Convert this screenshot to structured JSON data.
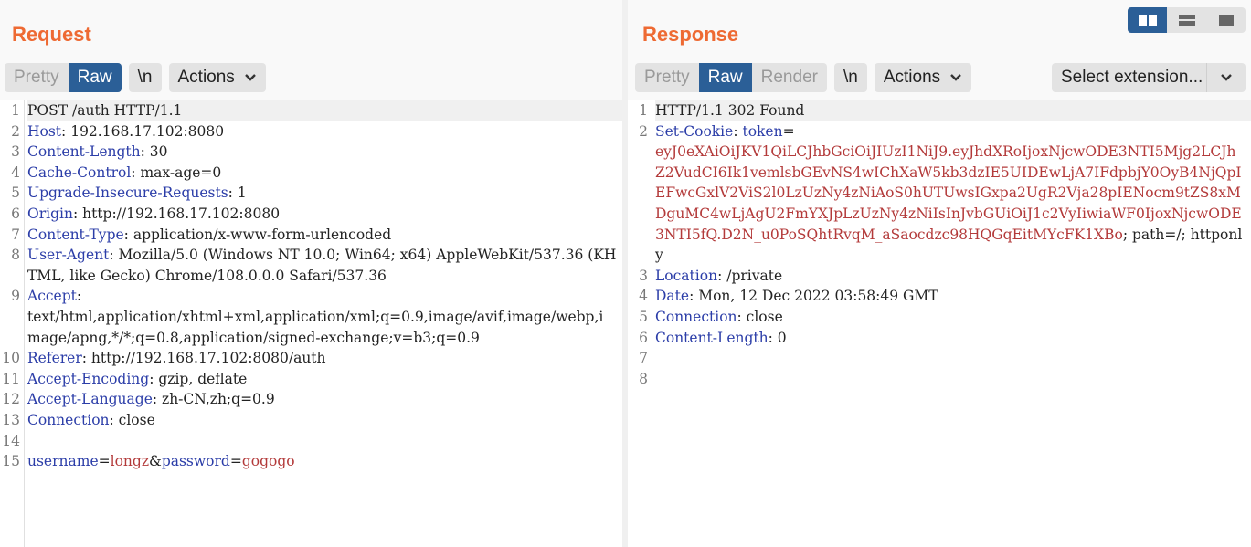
{
  "request": {
    "title": "Request",
    "tabs": [
      "Pretty",
      "Raw"
    ],
    "newline_label": "\\n",
    "actions_label": "Actions",
    "lines": [
      {
        "no": "1",
        "text": "POST /auth HTTP/1.1"
      },
      {
        "no": "2",
        "key": "Host",
        "sep": ": ",
        "value": "192.168.17.102:8080"
      },
      {
        "no": "3",
        "key": "Content-Length",
        "sep": ": ",
        "value": "30"
      },
      {
        "no": "4",
        "key": "Cache-Control",
        "sep": ": ",
        "value": "max-age=0"
      },
      {
        "no": "5",
        "key": "Upgrade-Insecure-Requests",
        "sep": ": ",
        "value": "1"
      },
      {
        "no": "6",
        "key": "Origin",
        "sep": ": ",
        "value": "http://192.168.17.102:8080"
      },
      {
        "no": "7",
        "key": "Content-Type",
        "sep": ": ",
        "value": "application/x-www-form-urlencoded"
      },
      {
        "no": "8",
        "key": "User-Agent",
        "sep": ": ",
        "value": "Mozilla/5.0 (Windows NT 10.0; Win64; x64) AppleWebKit/537.36 (KHTML, like Gecko) Chrome/108.0.0.0 Safari/537.36"
      },
      {
        "no": "9",
        "key": "Accept",
        "sep": ":",
        "value": "\ntext/html,application/xhtml+xml,application/xml;q=0.9,image/avif,image/webp,image/apng,*/*;q=0.8,application/signed-exchange;v=b3;q=0.9"
      },
      {
        "no": "10",
        "key": "Referer",
        "sep": ": ",
        "value": "http://192.168.17.102:8080/auth"
      },
      {
        "no": "11",
        "key": "Accept-Encoding",
        "sep": ": ",
        "value": "gzip, deflate"
      },
      {
        "no": "12",
        "key": "Accept-Language",
        "sep": ": ",
        "value": "zh-CN,zh;q=0.9"
      },
      {
        "no": "13",
        "key": "Connection",
        "sep": ": ",
        "value": "close"
      },
      {
        "no": "14",
        "text": ""
      },
      {
        "no": "15",
        "body": [
          {
            "k": "username",
            "v": "longz"
          },
          {
            "k": "password",
            "v": "gogogo"
          }
        ]
      }
    ]
  },
  "response": {
    "title": "Response",
    "tabs": [
      "Pretty",
      "Raw",
      "Render"
    ],
    "newline_label": "\\n",
    "actions_label": "Actions",
    "select_extension_label": "Select extension...",
    "view_modes": [
      "split-horizontal-icon",
      "split-vertical-icon",
      "single-pane-icon"
    ],
    "lines": [
      {
        "no": "1",
        "text": "HTTP/1.1 302 Found"
      },
      {
        "no": "2",
        "key": "Set-Cookie",
        "sep": ": ",
        "cookie_name": "token",
        "cookie_eq": "=",
        "cookie_value": "\neyJ0eXAiOiJKV1QiLCJhbGciOiJIUzI1NiJ9.eyJhdXRoIjoxNjcwODE3NTI5Mjg2LCJhZ2VudCI6Ik1vemlsbGEvNS4wIChXaW5kb3dzIE5UIDEwLjA7IFdpbjY0OyB4NjQpIEFwcGxlV2ViS2l0LzUzNy4zNiAoS0hUTUwsIGxpa2UgR2Vja28pIENocm9tZS8xMDguMC4wLjAgU2FmYXJpLzUzNy4zNiIsInJvbGUiOiJ1c2VyIiwiaWF0IjoxNjcwODE3NTI5fQ.D2N_u0PoSQhtRvqM_aSaocdzc98HQGqEitMYcFK1XBo",
        "cookie_rest": "; path=/; httponly"
      },
      {
        "no": "3",
        "key": "Location",
        "sep": ": ",
        "value": "/private"
      },
      {
        "no": "4",
        "key": "Date",
        "sep": ": ",
        "value": "Mon, 12 Dec 2022 03:58:49 GMT"
      },
      {
        "no": "5",
        "key": "Connection",
        "sep": ": ",
        "value": "close"
      },
      {
        "no": "6",
        "key": "Content-Length",
        "sep": ": ",
        "value": "0"
      },
      {
        "no": "7",
        "text": ""
      },
      {
        "no": "8",
        "text": ""
      }
    ]
  },
  "colors": {
    "title": "#ee6a33",
    "active_tab": "#2b5f97",
    "header_key": "#2b3da8",
    "param_value": "#b33a3a"
  }
}
